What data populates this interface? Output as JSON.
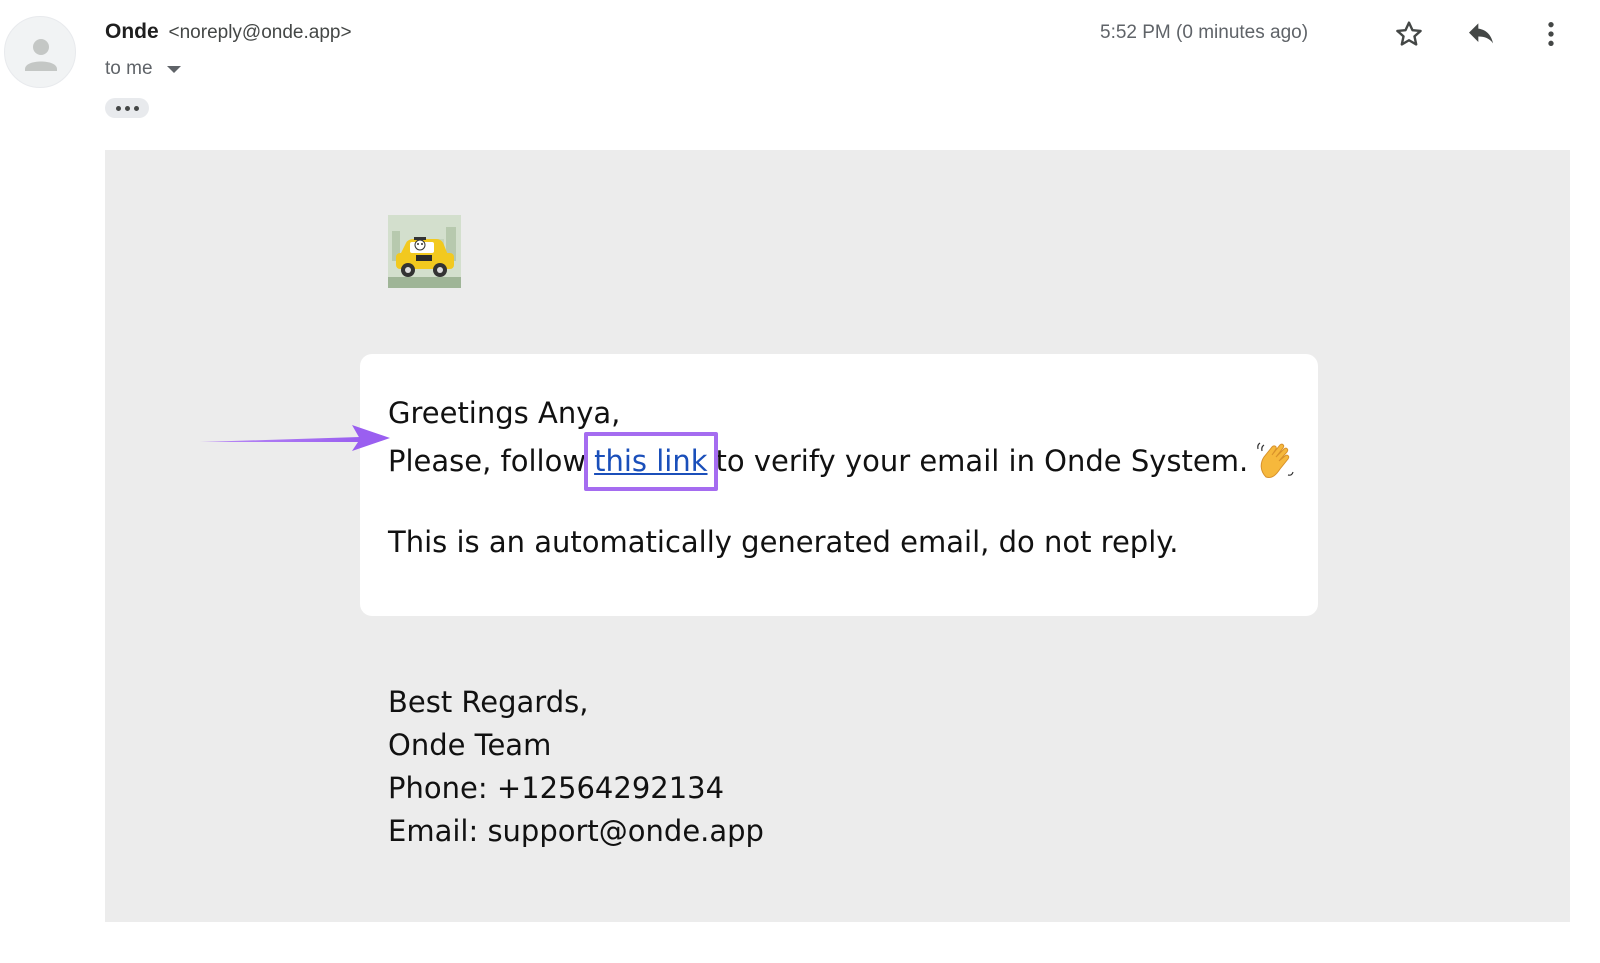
{
  "header": {
    "sender_name": "Onde",
    "sender_email": "<noreply@onde.app>",
    "recipient": "to me",
    "timestamp": "5:52 PM (0 minutes ago)",
    "icons": [
      "avatar-icon",
      "star-icon",
      "reply-icon",
      "more-vert-icon"
    ]
  },
  "body": {
    "greeting": "Greetings Anya,",
    "verify_prefix": "Please, follow",
    "verify_link": "this link",
    "verify_suffix": "to verify your email in Onde System.",
    "notice": "This is an automatically generated email, do not reply.",
    "signature": {
      "closing": "Best Regards,",
      "team": "Onde Team",
      "phone": "Phone: +12564292134",
      "email": "Email: support@onde.app"
    }
  },
  "colors": {
    "body_background": "#ececec",
    "link": "#1a4fba",
    "highlight": "#a56cf0"
  }
}
